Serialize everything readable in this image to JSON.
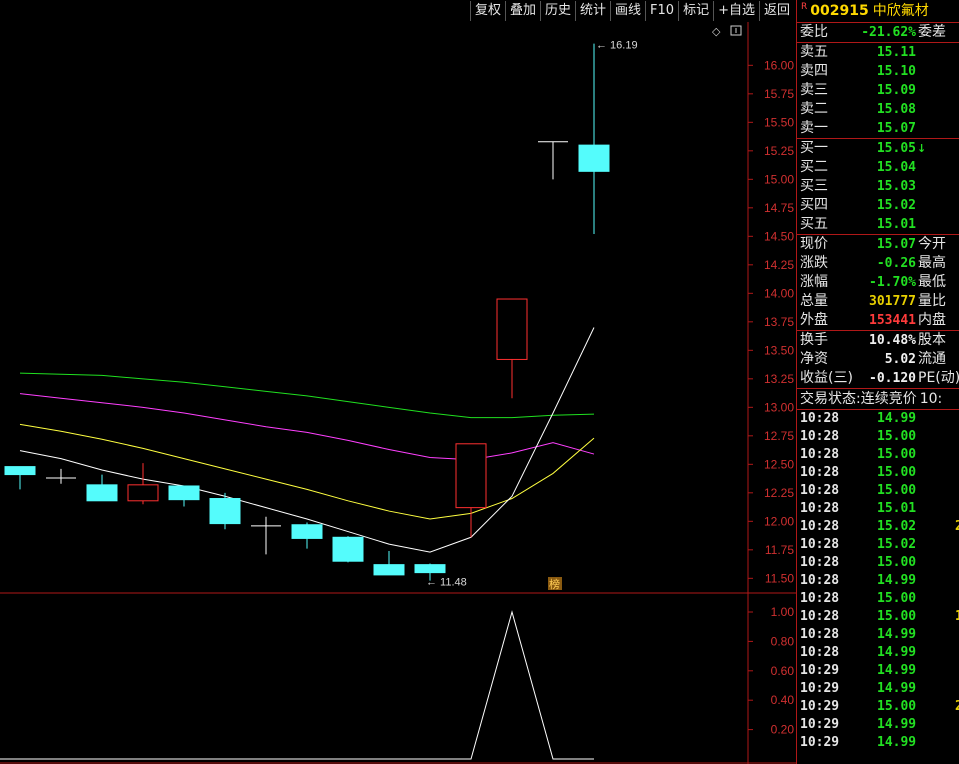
{
  "toolbar": {
    "buttons": [
      "复权",
      "叠加",
      "历史",
      "统计",
      "画线",
      "F10",
      "标记",
      "+自选",
      "返回"
    ]
  },
  "stock": {
    "badge": "R",
    "code": "002915",
    "name": "中欣氟材"
  },
  "weibi": {
    "label": "委比",
    "value": "-21.62%",
    "label2": "委差"
  },
  "sells": [
    {
      "label": "卖五",
      "price": "15.11"
    },
    {
      "label": "卖四",
      "price": "15.10"
    },
    {
      "label": "卖三",
      "price": "15.09"
    },
    {
      "label": "卖二",
      "price": "15.08"
    },
    {
      "label": "卖一",
      "price": "15.07"
    }
  ],
  "buys": [
    {
      "label": "买一",
      "price": "15.05",
      "arrow": "↓"
    },
    {
      "label": "买二",
      "price": "15.04"
    },
    {
      "label": "买三",
      "price": "15.03"
    },
    {
      "label": "买四",
      "price": "15.02"
    },
    {
      "label": "买五",
      "price": "15.01"
    }
  ],
  "quote": [
    {
      "label": "现价",
      "value": "15.07",
      "label2": "今开",
      "color": "#22e022"
    },
    {
      "label": "涨跌",
      "value": "-0.26",
      "label2": "最高",
      "color": "#22e022"
    },
    {
      "label": "涨幅",
      "value": "-1.70%",
      "label2": "最低",
      "color": "#22e022"
    },
    {
      "label": "总量",
      "value": "301777",
      "label2": "量比",
      "color": "#e8d000"
    },
    {
      "label": "外盘",
      "value": "153441",
      "label2": "内盘",
      "color": "#ff3b3b"
    }
  ],
  "fund": [
    {
      "label": "换手",
      "value": "10.48%",
      "label2": "股本"
    },
    {
      "label": "净资",
      "value": "5.02",
      "label2": "流通"
    },
    {
      "label": "收益(三)",
      "value": "-0.120",
      "label2": "PE(动)"
    }
  ],
  "trade_state": {
    "label": "交易状态:",
    "value": "连续竞价",
    "extra": "10:"
  },
  "trades": [
    {
      "time": "10:28",
      "price": "14.99"
    },
    {
      "time": "10:28",
      "price": "15.00"
    },
    {
      "time": "10:28",
      "price": "15.00"
    },
    {
      "time": "10:28",
      "price": "15.00"
    },
    {
      "time": "10:28",
      "price": "15.00"
    },
    {
      "time": "10:28",
      "price": "15.01"
    },
    {
      "time": "10:28",
      "price": "15.02",
      "extra": "2"
    },
    {
      "time": "10:28",
      "price": "15.02"
    },
    {
      "time": "10:28",
      "price": "15.00"
    },
    {
      "time": "10:28",
      "price": "14.99"
    },
    {
      "time": "10:28",
      "price": "15.00"
    },
    {
      "time": "10:28",
      "price": "15.00",
      "extra": "1"
    },
    {
      "time": "10:28",
      "price": "14.99"
    },
    {
      "time": "10:28",
      "price": "14.99"
    },
    {
      "time": "10:29",
      "price": "14.99"
    },
    {
      "time": "10:29",
      "price": "14.99"
    },
    {
      "time": "10:29",
      "price": "15.00",
      "extra": "2"
    },
    {
      "time": "10:29",
      "price": "14.99"
    },
    {
      "time": "10:29",
      "price": "14.99"
    }
  ],
  "chart_data": {
    "type": "candlestick",
    "y_ticks": [
      "16.00",
      "15.75",
      "15.50",
      "15.25",
      "15.00",
      "14.75",
      "14.50",
      "14.25",
      "14.00",
      "13.75",
      "13.50",
      "13.25",
      "13.00",
      "12.75",
      "12.50",
      "12.25",
      "12.00",
      "11.75",
      "11.50"
    ],
    "ylim": [
      11.38,
      16.38
    ],
    "candles": [
      {
        "o": 12.48,
        "c": 12.41,
        "h": 12.48,
        "l": 12.28
      },
      {
        "o": 12.38,
        "c": 12.38,
        "h": 12.46,
        "l": 12.33
      },
      {
        "o": 12.32,
        "c": 12.18,
        "h": 12.41,
        "l": 12.18
      },
      {
        "o": 12.18,
        "c": 12.32,
        "h": 12.51,
        "l": 12.15
      },
      {
        "o": 12.31,
        "c": 12.19,
        "h": 12.31,
        "l": 12.13
      },
      {
        "o": 12.2,
        "c": 11.98,
        "h": 12.25,
        "l": 11.93
      },
      {
        "o": 11.96,
        "c": 11.96,
        "h": 12.04,
        "l": 11.71
      },
      {
        "o": 11.97,
        "c": 11.85,
        "h": 11.99,
        "l": 11.76
      },
      {
        "o": 11.86,
        "c": 11.65,
        "h": 11.87,
        "l": 11.64
      },
      {
        "o": 11.62,
        "c": 11.53,
        "h": 11.74,
        "l": 11.53
      },
      {
        "o": 11.62,
        "c": 11.55,
        "h": 11.63,
        "l": 11.48
      },
      {
        "o": 12.12,
        "c": 12.68,
        "h": 12.68,
        "l": 11.86
      },
      {
        "o": 13.42,
        "c": 13.95,
        "h": 13.95,
        "l": 13.08
      },
      {
        "o": 15.33,
        "c": 15.33,
        "h": 15.33,
        "l": 15.0
      },
      {
        "o": 15.3,
        "c": 15.07,
        "h": 16.19,
        "l": 14.52
      }
    ],
    "ma_white": [
      12.62,
      12.55,
      12.45,
      12.37,
      12.31,
      12.22,
      12.12,
      12.02,
      11.91,
      11.8,
      11.73,
      11.86,
      12.22,
      12.95,
      13.7
    ],
    "ma_yellow": [
      12.85,
      12.79,
      12.72,
      12.64,
      12.55,
      12.46,
      12.37,
      12.28,
      12.18,
      12.09,
      12.02,
      12.07,
      12.2,
      12.42,
      12.73
    ],
    "ma_magenta": [
      13.12,
      13.08,
      13.04,
      13.0,
      12.95,
      12.89,
      12.83,
      12.78,
      12.71,
      12.63,
      12.56,
      12.54,
      12.6,
      12.69,
      12.59
    ],
    "ma_green": [
      13.3,
      13.29,
      13.28,
      13.25,
      13.22,
      13.18,
      13.14,
      13.1,
      13.05,
      13.0,
      12.95,
      12.91,
      12.91,
      12.93,
      12.94
    ],
    "annotations": {
      "high": "16.19",
      "low": "11.48",
      "marker": "榜"
    },
    "indicator": {
      "y_ticks": [
        "1.00",
        "0.80",
        "0.60",
        "0.40",
        "0.20"
      ],
      "values": [
        0,
        0,
        0,
        0,
        0,
        0,
        0,
        0,
        0,
        0,
        0,
        0,
        1.0,
        0,
        0
      ]
    },
    "colors": {
      "up": "#ff3030",
      "down": "#54fcfc",
      "ma_white": "#ffffff",
      "ma_yellow": "#ffff40",
      "ma_magenta": "#ff40ff",
      "ma_green": "#20e020",
      "axis": "#b01818",
      "tick": "#d03030"
    }
  }
}
